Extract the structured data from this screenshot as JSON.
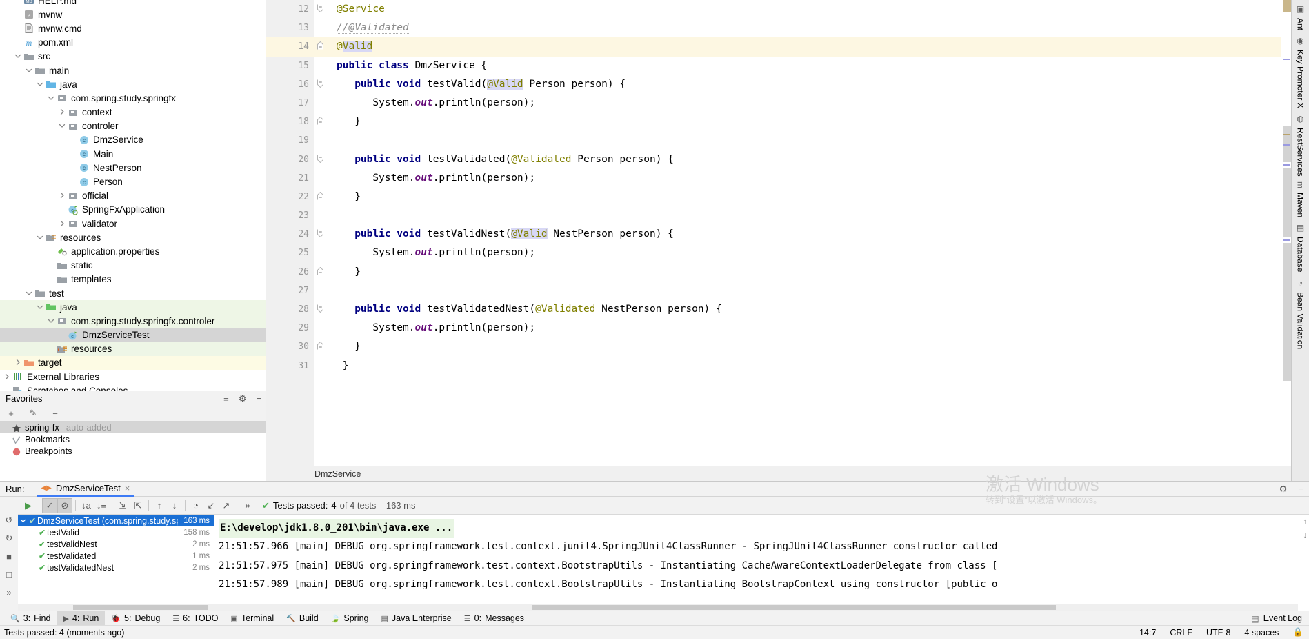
{
  "project_tree": [
    {
      "indent": 1,
      "twisty": "none",
      "icon": "md-file",
      "label": "HELP.md",
      "row_style": "none",
      "clipped_top": true
    },
    {
      "indent": 1,
      "twisty": "none",
      "icon": "script-file",
      "label": "mvnw",
      "row_style": "none"
    },
    {
      "indent": 1,
      "twisty": "none",
      "icon": "cmd-file",
      "label": "mvnw.cmd",
      "row_style": "none"
    },
    {
      "indent": 1,
      "twisty": "none",
      "icon": "maven-file",
      "label": "pom.xml",
      "row_style": "none"
    },
    {
      "indent": 1,
      "twisty": "open",
      "icon": "folder",
      "label": "src",
      "row_style": "none"
    },
    {
      "indent": 2,
      "twisty": "open",
      "icon": "folder",
      "label": "main",
      "row_style": "none"
    },
    {
      "indent": 3,
      "twisty": "open",
      "icon": "folder-src",
      "label": "java",
      "row_style": "none"
    },
    {
      "indent": 4,
      "twisty": "open",
      "icon": "package",
      "label": "com.spring.study.springfx",
      "row_style": "none"
    },
    {
      "indent": 5,
      "twisty": "closed",
      "icon": "package",
      "label": "context",
      "row_style": "none"
    },
    {
      "indent": 5,
      "twisty": "open",
      "icon": "package",
      "label": "controler",
      "row_style": "none"
    },
    {
      "indent": 6,
      "twisty": "none",
      "icon": "class",
      "label": "DmzService",
      "row_style": "none"
    },
    {
      "indent": 6,
      "twisty": "none",
      "icon": "class",
      "label": "Main",
      "row_style": "none"
    },
    {
      "indent": 6,
      "twisty": "none",
      "icon": "class",
      "label": "NestPerson",
      "row_style": "none"
    },
    {
      "indent": 6,
      "twisty": "none",
      "icon": "class",
      "label": "Person",
      "row_style": "none"
    },
    {
      "indent": 5,
      "twisty": "closed",
      "icon": "package",
      "label": "official",
      "row_style": "none"
    },
    {
      "indent": 5,
      "twisty": "none",
      "icon": "spring-class",
      "label": "SpringFxApplication",
      "row_style": "none"
    },
    {
      "indent": 5,
      "twisty": "closed",
      "icon": "package",
      "label": "validator",
      "row_style": "none"
    },
    {
      "indent": 3,
      "twisty": "open",
      "icon": "folder-res",
      "label": "resources",
      "row_style": "none"
    },
    {
      "indent": 4,
      "twisty": "none",
      "icon": "properties",
      "label": "application.properties",
      "row_style": "none"
    },
    {
      "indent": 4,
      "twisty": "none",
      "icon": "folder",
      "label": "static",
      "row_style": "none"
    },
    {
      "indent": 4,
      "twisty": "none",
      "icon": "folder",
      "label": "templates",
      "row_style": "none"
    },
    {
      "indent": 2,
      "twisty": "open",
      "icon": "folder",
      "label": "test",
      "row_style": "none"
    },
    {
      "indent": 3,
      "twisty": "open",
      "icon": "folder-test",
      "label": "java",
      "row_style": "green"
    },
    {
      "indent": 4,
      "twisty": "open",
      "icon": "package",
      "label": "com.spring.study.springfx.controler",
      "row_style": "green"
    },
    {
      "indent": 5,
      "twisty": "none",
      "icon": "test-class",
      "label": "DmzServiceTest",
      "row_style": "grey"
    },
    {
      "indent": 4,
      "twisty": "none",
      "icon": "folder-testres",
      "label": "resources",
      "row_style": "green"
    },
    {
      "indent": 1,
      "twisty": "closed",
      "icon": "folder-target",
      "label": "target",
      "row_style": "yellow"
    },
    {
      "indent": 0,
      "twisty": "closed",
      "icon": "libraries",
      "label": "External Libraries",
      "row_style": "none"
    },
    {
      "indent": 0,
      "twisty": "none",
      "icon": "scratches",
      "label": "Scratches and Consoles",
      "row_style": "none",
      "clipped_bottom": true
    }
  ],
  "favorites": {
    "title": "Favorites",
    "toolbar": [
      {
        "name": "add-icon",
        "glyph": "+"
      },
      {
        "name": "edit-icon",
        "glyph": "✎"
      },
      {
        "name": "remove-icon",
        "glyph": "−"
      }
    ],
    "header_actions": [
      {
        "name": "collapse-all-icon",
        "glyph": "≡"
      },
      {
        "name": "settings-gear-icon",
        "glyph": "⚙"
      },
      {
        "name": "hide-icon",
        "glyph": "−"
      }
    ],
    "items": [
      {
        "icon": "star-icon",
        "label": "spring-fx",
        "sub": "auto-added",
        "selected": true
      },
      {
        "icon": "bookmark-check-icon",
        "label": "Bookmarks",
        "sub": "",
        "selected": false
      },
      {
        "icon": "breakpoint-icon",
        "label": "Breakpoints",
        "sub": "",
        "selected": false
      }
    ]
  },
  "editor": {
    "breadcrumb": "DmzService",
    "lines": [
      {
        "num": 12,
        "gutter_icon": "spring-bean-run",
        "fold": "open-top",
        "highlight": false,
        "tokens": [
          {
            "t": "@Service",
            "c": "anno"
          }
        ]
      },
      {
        "num": 13,
        "gutter_icon": "",
        "fold": "",
        "highlight": false,
        "tokens": [
          {
            "t": "//@Validated",
            "c": "cmt wavy"
          }
        ]
      },
      {
        "num": 14,
        "gutter_icon": "",
        "fold": "close-bottom",
        "highlight": true,
        "tokens": [
          {
            "t": "@",
            "c": "anno"
          },
          {
            "t": "Valid",
            "c": "anno sel-token"
          }
        ]
      },
      {
        "num": 15,
        "gutter_icon": "class-run",
        "fold": "",
        "highlight": false,
        "tokens": [
          {
            "t": "public class ",
            "c": "kw"
          },
          {
            "t": "DmzService {",
            "c": ""
          }
        ]
      },
      {
        "num": 16,
        "gutter_icon": "",
        "fold": "open",
        "highlight": false,
        "indent": 3,
        "tokens": [
          {
            "t": "public void ",
            "c": "kw"
          },
          {
            "t": "testValid(",
            "c": ""
          },
          {
            "t": "@Valid",
            "c": "anno sel-token"
          },
          {
            "t": " Person person) {",
            "c": ""
          }
        ]
      },
      {
        "num": 17,
        "gutter_icon": "",
        "fold": "",
        "highlight": false,
        "indent": 6,
        "tokens": [
          {
            "t": "System.",
            "c": ""
          },
          {
            "t": "out",
            "c": "fld"
          },
          {
            "t": ".println(person);",
            "c": ""
          }
        ]
      },
      {
        "num": 18,
        "gutter_icon": "",
        "fold": "close",
        "highlight": false,
        "indent": 3,
        "tokens": [
          {
            "t": "}",
            "c": ""
          }
        ]
      },
      {
        "num": 19,
        "gutter_icon": "",
        "fold": "",
        "highlight": false,
        "tokens": []
      },
      {
        "num": 20,
        "gutter_icon": "",
        "fold": "open",
        "highlight": false,
        "indent": 3,
        "tokens": [
          {
            "t": "public void ",
            "c": "kw"
          },
          {
            "t": "testValidated(",
            "c": ""
          },
          {
            "t": "@Validated",
            "c": "anno"
          },
          {
            "t": " Person person) {",
            "c": ""
          }
        ]
      },
      {
        "num": 21,
        "gutter_icon": "",
        "fold": "",
        "highlight": false,
        "indent": 6,
        "tokens": [
          {
            "t": "System.",
            "c": ""
          },
          {
            "t": "out",
            "c": "fld"
          },
          {
            "t": ".println(person);",
            "c": ""
          }
        ]
      },
      {
        "num": 22,
        "gutter_icon": "",
        "fold": "close",
        "highlight": false,
        "indent": 3,
        "tokens": [
          {
            "t": "}",
            "c": ""
          }
        ]
      },
      {
        "num": 23,
        "gutter_icon": "",
        "fold": "",
        "highlight": false,
        "tokens": []
      },
      {
        "num": 24,
        "gutter_icon": "",
        "fold": "open",
        "highlight": false,
        "indent": 3,
        "tokens": [
          {
            "t": "public void ",
            "c": "kw"
          },
          {
            "t": "testValidNest(",
            "c": ""
          },
          {
            "t": "@Valid",
            "c": "anno sel-token"
          },
          {
            "t": " NestPerson person) {",
            "c": ""
          }
        ]
      },
      {
        "num": 25,
        "gutter_icon": "",
        "fold": "",
        "highlight": false,
        "indent": 6,
        "tokens": [
          {
            "t": "System.",
            "c": ""
          },
          {
            "t": "out",
            "c": "fld"
          },
          {
            "t": ".println(person);",
            "c": ""
          }
        ]
      },
      {
        "num": 26,
        "gutter_icon": "",
        "fold": "close",
        "highlight": false,
        "indent": 3,
        "tokens": [
          {
            "t": "}",
            "c": ""
          }
        ]
      },
      {
        "num": 27,
        "gutter_icon": "",
        "fold": "",
        "highlight": false,
        "tokens": []
      },
      {
        "num": 28,
        "gutter_icon": "",
        "fold": "open",
        "highlight": false,
        "indent": 3,
        "tokens": [
          {
            "t": "public void ",
            "c": "kw"
          },
          {
            "t": "testValidatedNest(",
            "c": ""
          },
          {
            "t": "@Validated",
            "c": "anno"
          },
          {
            "t": " NestPerson person) {",
            "c": ""
          }
        ]
      },
      {
        "num": 29,
        "gutter_icon": "",
        "fold": "",
        "highlight": false,
        "indent": 6,
        "tokens": [
          {
            "t": "System.",
            "c": ""
          },
          {
            "t": "out",
            "c": "fld"
          },
          {
            "t": ".println(person);",
            "c": ""
          }
        ]
      },
      {
        "num": 30,
        "gutter_icon": "",
        "fold": "close",
        "highlight": false,
        "indent": 3,
        "tokens": [
          {
            "t": "}",
            "c": ""
          }
        ]
      },
      {
        "num": 31,
        "gutter_icon": "",
        "fold": "",
        "highlight": false,
        "indent": 1,
        "tokens": [
          {
            "t": "}",
            "c": ""
          }
        ]
      }
    ]
  },
  "right_rail": [
    {
      "label": "Ant",
      "icon": "ant-icon"
    },
    {
      "label": "Key Promoter X",
      "icon": "key-promoter-icon"
    },
    {
      "label": "RestServices",
      "icon": "rest-services-icon"
    },
    {
      "label": "Maven",
      "icon": "maven-icon"
    },
    {
      "label": "Database",
      "icon": "database-icon"
    },
    {
      "label": "Bean Validation",
      "icon": "bean-validation-icon"
    }
  ],
  "run_window": {
    "label": "Run:",
    "tab": {
      "label": "DmzServiceTest",
      "icon": "rerun-icon",
      "close": "×"
    },
    "header_actions": [
      {
        "name": "settings-gear-icon",
        "glyph": "⚙"
      },
      {
        "name": "hide-icon",
        "glyph": "−"
      }
    ],
    "left_icons": [
      {
        "name": "rerun-icon",
        "glyph": "↺"
      },
      {
        "name": "rerun-failed-icon",
        "glyph": "↻"
      },
      {
        "name": "stop-icon",
        "glyph": "■"
      },
      {
        "name": "camera-icon",
        "glyph": "□"
      },
      {
        "name": "expand-panel-icon",
        "glyph": "»"
      }
    ],
    "toolbar": [
      {
        "name": "run-button",
        "glyph": "▶",
        "active": false,
        "color": "#4a9c4a"
      },
      {
        "name": "show-passed-toggle",
        "glyph": "✓",
        "active": true
      },
      {
        "name": "show-ignored-toggle",
        "glyph": "⊘",
        "active": true
      },
      {
        "name": "sort-alphabetically-button",
        "glyph": "↓a",
        "active": false
      },
      {
        "name": "sort-by-duration-button",
        "glyph": "↓≡",
        "active": false
      },
      {
        "name": "expand-all-button",
        "glyph": "⇲",
        "active": false
      },
      {
        "name": "collapse-all-button",
        "glyph": "⇱",
        "active": false
      },
      {
        "name": "prev-failed-button",
        "glyph": "↑",
        "active": false
      },
      {
        "name": "next-failed-button",
        "glyph": "↓",
        "active": false
      },
      {
        "name": "history-button",
        "glyph": "◔",
        "active": false
      },
      {
        "name": "import-results-button",
        "glyph": "↙",
        "active": false
      },
      {
        "name": "export-results-button",
        "glyph": "↗",
        "active": false
      },
      {
        "name": "more-button",
        "glyph": "»",
        "active": false
      }
    ],
    "status": {
      "prefix": "Tests passed:",
      "count": "4",
      "detail": "of 4 tests – 163 ms"
    },
    "tests": [
      {
        "name": "DmzServiceTest (com.spring.study.spring",
        "time": "163 ms",
        "level": 0,
        "selected": true,
        "expanded": true
      },
      {
        "name": "testValid",
        "time": "158 ms",
        "level": 1,
        "selected": false
      },
      {
        "name": "testValidNest",
        "time": "2 ms",
        "level": 1,
        "selected": false
      },
      {
        "name": "testValidated",
        "time": "1 ms",
        "level": 1,
        "selected": false
      },
      {
        "name": "testValidatedNest",
        "time": "2 ms",
        "level": 1,
        "selected": false
      }
    ],
    "console": [
      {
        "text": "E:\\develop\\jdk1.8.0_201\\bin\\java.exe ...",
        "style": "cmd"
      },
      {
        "text": "21:51:57.966 [main] DEBUG org.springframework.test.context.junit4.SpringJUnit4ClassRunner - SpringJUnit4ClassRunner constructor called",
        "style": "plain"
      },
      {
        "text": "21:51:57.975 [main] DEBUG org.springframework.test.context.BootstrapUtils - Instantiating CacheAwareContextLoaderDelegate from class [",
        "style": "plain"
      },
      {
        "text": "21:51:57.989 [main] DEBUG org.springframework.test.context.BootstrapUtils - Instantiating BootstrapContext using constructor [public o",
        "style": "plain"
      }
    ]
  },
  "bottom_tabs": [
    {
      "num": "3",
      "label": "Find",
      "icon": "search-icon",
      "active": false
    },
    {
      "num": "4",
      "label": "Run",
      "icon": "run-icon",
      "active": true
    },
    {
      "num": "5",
      "label": "Debug",
      "icon": "debug-icon",
      "active": false
    },
    {
      "num": "6",
      "label": "TODO",
      "icon": "todo-icon",
      "active": false
    },
    {
      "num": "",
      "label": "Terminal",
      "icon": "terminal-icon",
      "active": false
    },
    {
      "num": "",
      "label": "Build",
      "icon": "build-icon",
      "active": false
    },
    {
      "num": "",
      "label": "Spring",
      "icon": "spring-icon",
      "active": false
    },
    {
      "num": "",
      "label": "Java Enterprise",
      "icon": "java-ee-icon",
      "active": false
    },
    {
      "num": "0",
      "label": "Messages",
      "icon": "messages-icon",
      "active": false
    }
  ],
  "bottom_right": {
    "label": "Event Log",
    "icon": "event-log-icon"
  },
  "status_bar": {
    "message": "Tests passed: 4 (moments ago)",
    "caret": "14:7",
    "line_sep": "CRLF",
    "encoding": "UTF-8",
    "indent": "4 spaces"
  },
  "watermark": {
    "line1": "激活 Windows",
    "line2": "转到“设置”以激活 Windows。"
  },
  "colors": {
    "accent": "#3d7bf5",
    "selection_blue": "#1a6fd4",
    "pass_green": "#4caf50",
    "annotation": "#808000",
    "keyword": "#000080",
    "highlight_line": "#fdf7e2",
    "token_selection": "#d8d8f5"
  }
}
